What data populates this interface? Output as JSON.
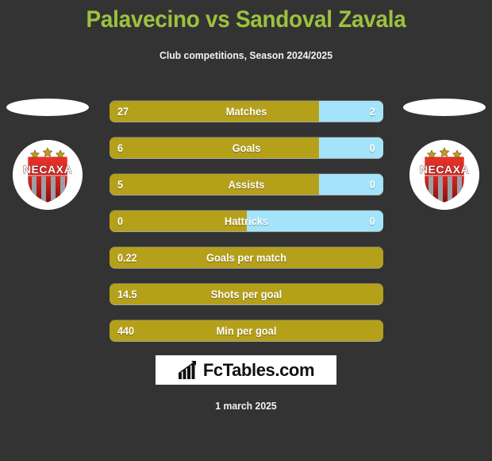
{
  "header": {
    "title": "Palavecino vs Sandoval Zavala",
    "subtitle": "Club competitions, Season 2024/2025",
    "title_color": "#9dc13e",
    "subtitle_color": "#f2f2f2"
  },
  "theme": {
    "background": "#333333",
    "home_bar_color": "#b5a01a",
    "away_bar_color": "#a3e4fa",
    "bar_text_color": "#ffffff"
  },
  "players": {
    "home": {
      "name": "Palavecino",
      "club_badge": "necaxa-crest",
      "club_name": "NECAXA"
    },
    "away": {
      "name": "Sandoval Zavala",
      "club_badge": "necaxa-crest",
      "club_name": "NECAXA"
    }
  },
  "stats": [
    {
      "label": "Matches",
      "home": "27",
      "away": "2",
      "home_pct": 76.5,
      "split": true
    },
    {
      "label": "Goals",
      "home": "6",
      "away": "0",
      "home_pct": 76.5,
      "split": true
    },
    {
      "label": "Assists",
      "home": "5",
      "away": "0",
      "home_pct": 76.5,
      "split": true
    },
    {
      "label": "Hattricks",
      "home": "0",
      "away": "0",
      "home_pct": 50.0,
      "split": true
    },
    {
      "label": "Goals per match",
      "home": "0.22",
      "away": "",
      "home_pct": 100,
      "split": false
    },
    {
      "label": "Shots per goal",
      "home": "14.5",
      "away": "",
      "home_pct": 100,
      "split": false
    },
    {
      "label": "Min per goal",
      "home": "440",
      "away": "",
      "home_pct": 100,
      "split": false
    }
  ],
  "logo": {
    "text": "FcTables.com",
    "icon": "bar-chart-arrow-icon"
  },
  "footer": {
    "date": "1 march 2025"
  }
}
